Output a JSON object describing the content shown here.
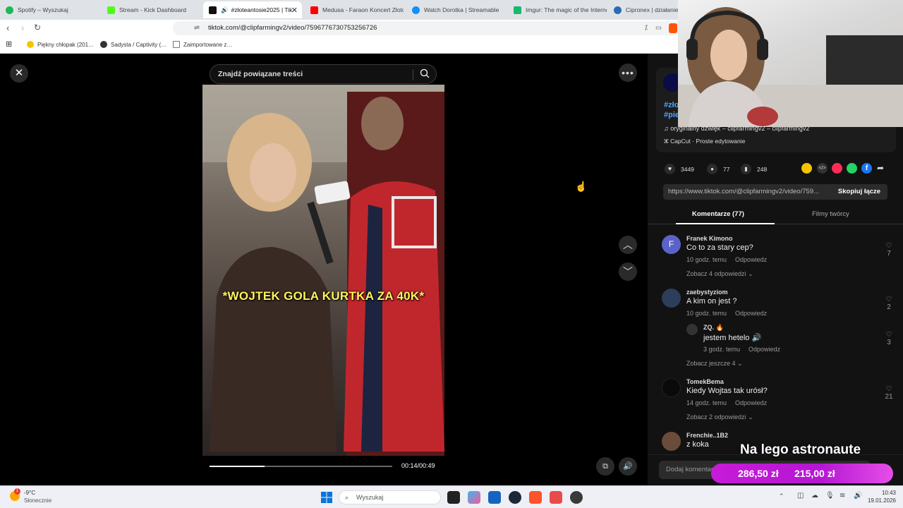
{
  "tabs": [
    {
      "label": "Spotify – Wyszukaj",
      "color": "#1db954"
    },
    {
      "label": "Stream - Kick Dashboard",
      "color": "#53fc18"
    },
    {
      "label": "#złoteantosie2025 | Tik",
      "color": "#111111"
    },
    {
      "label": "Medusa - Faraon Koncert Złoto",
      "color": "#ff0000"
    },
    {
      "label": "Watch Dorotka | Streamable",
      "color": "#0f90fa"
    },
    {
      "label": "Imgur: The magic of the Interne",
      "color": "#1bb76e"
    },
    {
      "label": "Cipronex | działanie, da",
      "color": "#2b6cb0"
    }
  ],
  "address": {
    "url": "tiktok.com/@clipfarmingv2/video/7596776730753256726"
  },
  "bookmarks": [
    {
      "label": "Piękny chłopak (201…",
      "color": "#f5c400"
    },
    {
      "label": "Sadysta / Captivity (…",
      "color": "#333333"
    },
    {
      "label": "Zaimportowane z…",
      "color": "#777777"
    }
  ],
  "video": {
    "search_placeholder": "Znajdź powiązane treści",
    "caption": "*WOJTEK GOLA KURTKA ZA 40K*",
    "time": "00:14/00:49",
    "progress": 0.3
  },
  "panel": {
    "hashtag1": "#zło",
    "hashtag2": "#pie",
    "sound": "oryginalny dźwięk – clipfarmingv2 – clipfarmingv2",
    "capcut": "CapCut · Proste edytowanie",
    "likes": "3449",
    "comments_count": "77",
    "saves": "248",
    "link": "https://www.tiktok.com/@clipfarmingv2/video/759...",
    "copy_label": "Skopiuj łącze",
    "tab_comments": "Komentarze (77)",
    "tab_creator": "Filmy twórcy",
    "comment_input_placeholder": "Dodaj komentarz..."
  },
  "comments": [
    {
      "avatar_letter": "F",
      "name": "Franek Kimono",
      "text": "Co to za stary cep?",
      "time": "10 godz. temu",
      "reply": "Odpowiedz",
      "likes": "7",
      "more": "Zobacz 4 odpowiedzi"
    },
    {
      "name": "zaebystyziom",
      "text": "A kim on jest ?",
      "time": "10 godz. temu",
      "reply": "Odpowiedz",
      "likes": "2",
      "more": "Zobacz jeszcze 4"
    },
    {
      "name": "TomekBema",
      "text": "Kiedy Wojtas tak urósł?",
      "time": "14 godz. temu",
      "reply": "Odpowiedz",
      "likes": "21",
      "more": "Zobacz 2 odpowiedzi"
    },
    {
      "name": "Frenchie..1B2",
      "text": "z koka"
    }
  ],
  "reply": {
    "name": "ZQ.",
    "text": "jestem hetelo",
    "time": "3 godz. temu",
    "reply": "Odpowiedz",
    "likes": "3"
  },
  "overlay": {
    "title": "Na lego astronaute",
    "amount1": "286,50 zł",
    "amount2": "215,00 zł"
  },
  "taskbar": {
    "weather_temp": "-9°C",
    "weather_desc": "Słonecznie",
    "search": "Wyszukaj",
    "time": "10:43",
    "date": "19.01.2026"
  }
}
